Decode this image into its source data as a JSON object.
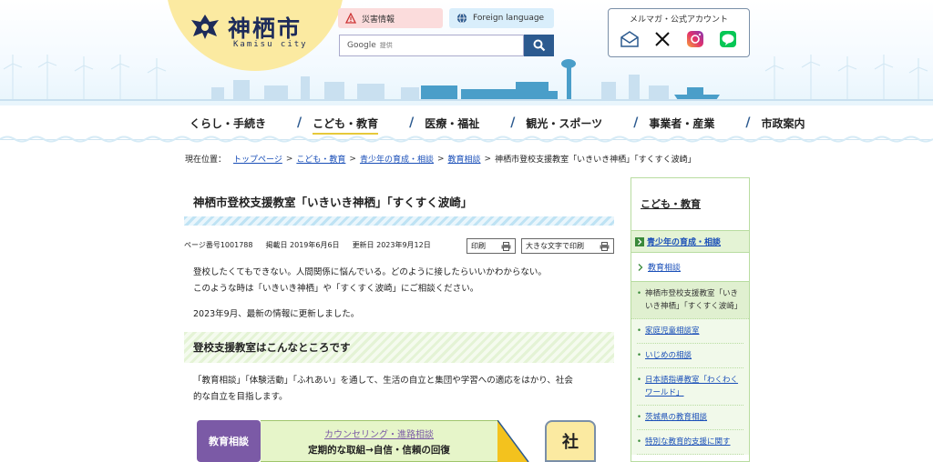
{
  "header": {
    "logo_title": "神栖市",
    "logo_sub": "Kamisu city",
    "disaster_label": "災害情報",
    "language_label": "Foreign language",
    "search_brand": "Google",
    "search_placeholder": "提供",
    "sns_title": "メルマガ・公式アカウント",
    "sns_icons": [
      "mail-icon",
      "x-icon",
      "instagram-icon",
      "line-icon"
    ]
  },
  "nav": {
    "items": [
      "くらし・手続き",
      "こども・教育",
      "医療・福祉",
      "観光・スポーツ",
      "事業者・産業",
      "市政案内"
    ],
    "active": 1
  },
  "breadcrumb": {
    "prefix": "現在位置：",
    "links": [
      "トップページ",
      "こども・教育",
      "青少年の育成・相談",
      "教育相談"
    ],
    "current": "神栖市登校支援教室「いきいき神栖」「すくすく波崎」"
  },
  "main": {
    "title": "神栖市登校支援教室「いきいき神栖」「すくすく波崎」",
    "page_no": "ページ番号1001788",
    "posted": "掲載日 2019年6月6日",
    "updated": "更新日 2023年9月12日",
    "print_label": "印刷",
    "print_large_label": "大きな文字で印刷",
    "para1_line1": "登校したくてもできない。人間関係に悩んでいる。どのように接したらいいかわからない。",
    "para1_line2": "このような時は「いきいき神栖」や「すくすく波崎」にご相談ください。",
    "para2": "2023年9月、最新の情報に更新しました。",
    "section_title": "登校支援教室はこんなところです",
    "para3_line1": "「教育相談」「体験活動」「ふれあい」を通して、生活の自立と集団や学習への適応をはかり、社会",
    "para3_line2": "的な自立を目指します。",
    "diagram": {
      "box_label": "教育相談",
      "top_text": "カウンセリング・進路相談",
      "bottom_text": "定期的な取組→自信・信頼の回復",
      "right_char": "社"
    }
  },
  "sidebar": {
    "heading": "こども・教育",
    "category": "青少年の育成・相談",
    "sub": "教育相談",
    "items": [
      "神栖市登校支援教室「いきいき神栖」「すくすく波崎」",
      "家庭児童相談室",
      "いじめの相談",
      "日本語指導教室「わくわくワールド」",
      "茨城県の教育相談",
      "特別な教育的支援に関す"
    ],
    "current_index": 0
  },
  "colors": {
    "accent": "#2c5a8f",
    "logo_bg": "#fbeaa1",
    "link": "#1a4fb8",
    "active_underline": "#e7c93a"
  }
}
